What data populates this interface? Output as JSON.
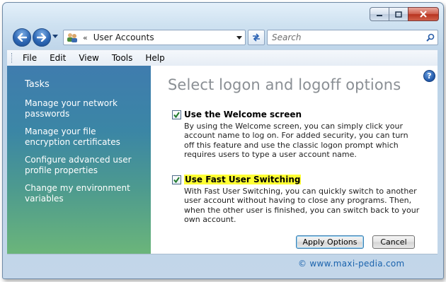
{
  "window": {
    "caption_buttons": [
      "minimize",
      "maximize",
      "close"
    ]
  },
  "navigation": {
    "address_chevron": "«",
    "address_text": "User Accounts",
    "search_placeholder": "Search"
  },
  "menu": {
    "items": [
      "File",
      "Edit",
      "View",
      "Tools",
      "Help"
    ]
  },
  "sidebar": {
    "title": "Tasks",
    "links": [
      "Manage your network passwords",
      "Manage your file encryption certificates",
      "Configure advanced user profile properties",
      "Change my environment variables"
    ]
  },
  "main": {
    "help_glyph": "?",
    "title": "Select logon and logoff options",
    "options": [
      {
        "label": "Use the Welcome screen",
        "checked": true,
        "description": "By using the Welcome screen, you can simply click your account name to log on. For added security, you can turn off this feature and use the classic logon prompt which requires users to type a user account name."
      },
      {
        "label": "Use Fast User Switching",
        "checked": true,
        "highlighted": true,
        "description": "With Fast User Switching, you can quickly switch to another user account without having to close any programs. Then, when the other user is finished, you can switch back to your own account."
      }
    ],
    "apply_label": "Apply Options",
    "cancel_label": "Cancel"
  },
  "watermark": "© www.maxi-pedia.com",
  "colors": {
    "sidebar_top": "#3f7cae",
    "sidebar_bottom": "#6bb57a",
    "title_gray": "#8a8f94",
    "highlight": "#ffff33",
    "watermark": "#1a63ad"
  }
}
